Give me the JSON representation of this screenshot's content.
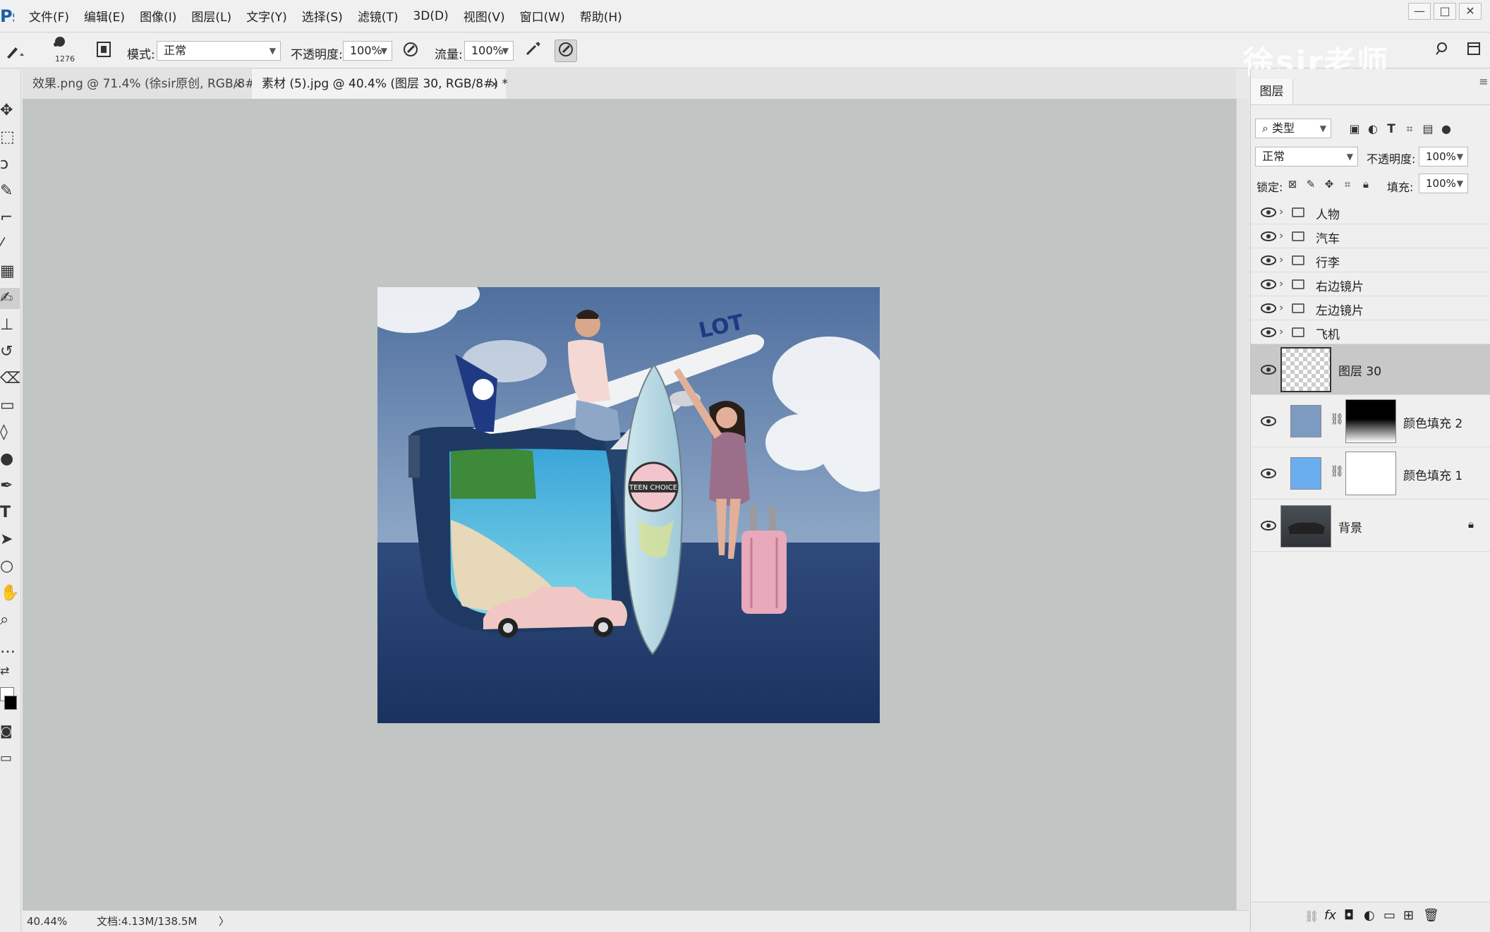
{
  "app": {
    "logo": "Ps"
  },
  "menu": [
    "文件(F)",
    "编辑(E)",
    "图像(I)",
    "图层(L)",
    "文字(Y)",
    "选择(S)",
    "滤镜(T)",
    "3D(D)",
    "视图(V)",
    "窗口(W)",
    "帮助(H)"
  ],
  "window_controls": {
    "minimize": "—",
    "maximize": "□",
    "close": "✕"
  },
  "options": {
    "brush_size": "1276",
    "mode_label": "模式:",
    "mode_value": "正常",
    "opacity_label": "不透明度:",
    "opacity_value": "100%",
    "flow_label": "流量:",
    "flow_value": "100%"
  },
  "watermark": "徐sir老师",
  "tabs": [
    {
      "label": "效果.png @ 71.4% (徐sir原创, RGB/8#) *",
      "active": false,
      "close": "×"
    },
    {
      "label": "素材 (5).jpg @ 40.4% (图层 30, RGB/8#) *",
      "active": true,
      "close": "×"
    }
  ],
  "status": {
    "zoom": "40.44%",
    "doc": "文档:4.13M/138.5M",
    "arrow": "〉"
  },
  "layers_panel": {
    "tab": "图层",
    "filter_label": "类型",
    "blend_mode": "正常",
    "opacity_label": "不透明度:",
    "opacity_value": "100%",
    "lock_label": "锁定:",
    "fill_label": "填充:",
    "fill_value": "100%",
    "groups": [
      "人物",
      "汽车",
      "行李",
      "右边镜片",
      "左边镜片",
      "飞机"
    ],
    "layer30": "图层 30",
    "fill2": "颜色填充 2",
    "fill1": "颜色填充 1",
    "background": "背景",
    "fx": "fx"
  },
  "artwork_text": {
    "airline": "LOT",
    "surfboard": "TEEN CHOICE"
  },
  "colors": {
    "accent": "#1a5fa8",
    "canvas_bg": "#c1c6c4",
    "selected_layer": "#c8c8c8",
    "fill2_color": "#7d9bc1",
    "fill1_color": "#6aaef0"
  }
}
